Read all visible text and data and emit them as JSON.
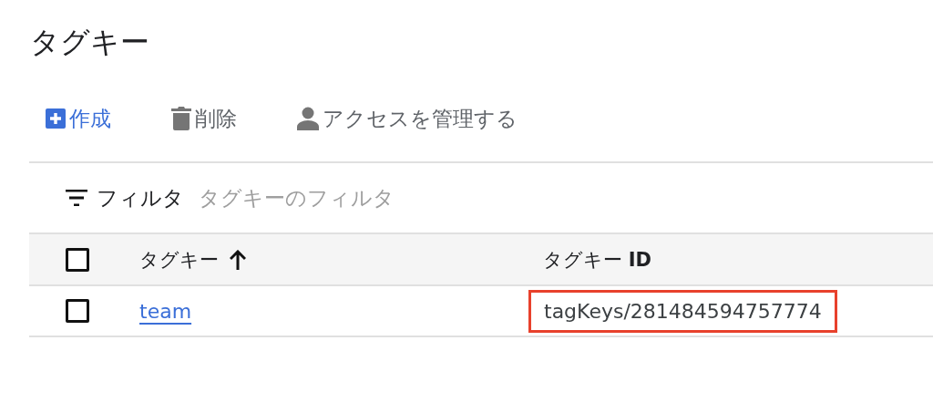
{
  "title": "タグキー",
  "toolbar": [
    {
      "kind": "create",
      "label": "作成"
    },
    {
      "kind": "delete",
      "label": "削除"
    },
    {
      "kind": "access",
      "label": "アクセスを管理する"
    }
  ],
  "filter": {
    "label": "フィルタ",
    "placeholder": "タグキーのフィルタ"
  },
  "table": {
    "columns": [
      {
        "label": "タグキー",
        "sorted_ascending": true
      },
      {
        "label": "タグキー **ID**",
        "sorted_ascending": false
      }
    ],
    "header_checked": false,
    "rows": [
      {
        "checked": false,
        "name": "team",
        "id": "tagKeys/281484594757774",
        "highlighted": true
      }
    ]
  }
}
